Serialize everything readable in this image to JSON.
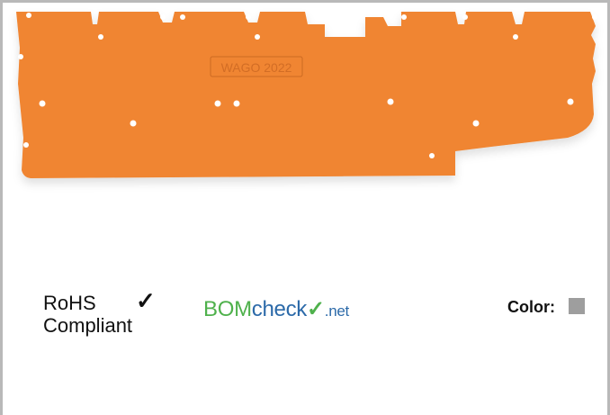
{
  "product": {
    "image_name": "orange-end-plate",
    "imprint": "WAGO 2022",
    "color_hex": "#f08531"
  },
  "badges": {
    "rohs_line1": "RoHS",
    "rohs_line2": "Compliant",
    "rohs_check": "✓",
    "bomcheck_part1": "BOM",
    "bomcheck_part2": "check",
    "bomcheck_tick": "✓",
    "bomcheck_part3": ".net",
    "bomcheck_green": "#4fb14c",
    "bomcheck_blue": "#2c6aa9"
  },
  "color_indicator": {
    "label": "Color:",
    "swatch_hex": "#9e9e9e"
  }
}
